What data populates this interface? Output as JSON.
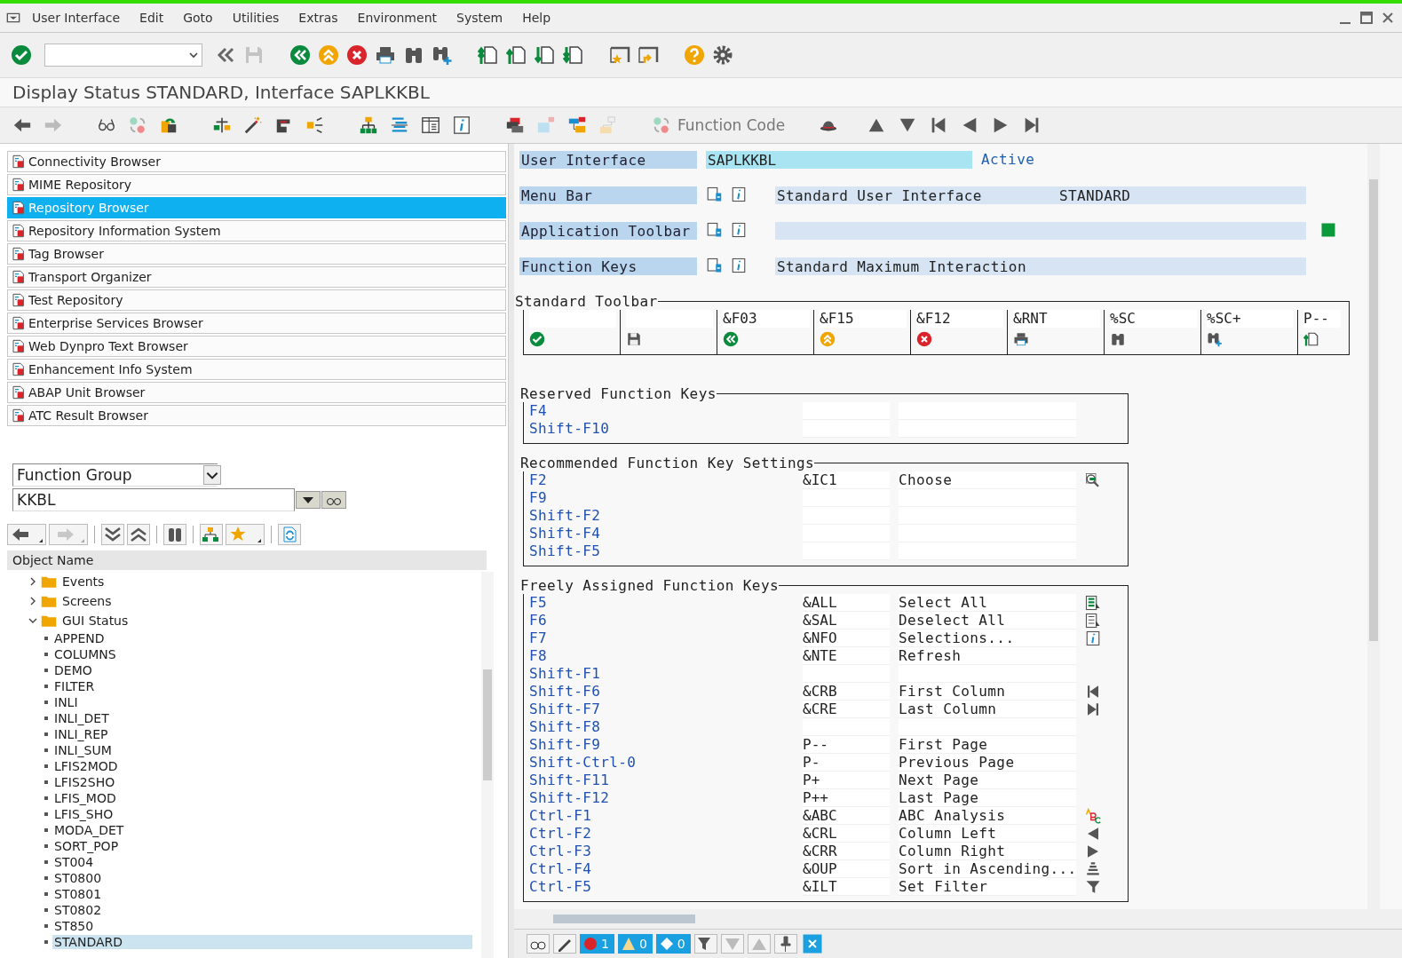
{
  "menu_bar": [
    "User Interface",
    "Edit",
    "Goto",
    "Utilities",
    "Extras",
    "Environment",
    "System",
    "Help"
  ],
  "title": "Display Status STANDARD, Interface SAPLKKBL",
  "app_toolbar": {
    "function_code": "Function Code"
  },
  "navigator": {
    "items": [
      {
        "label": "Connectivity Browser",
        "selected": false
      },
      {
        "label": "MIME Repository",
        "selected": false
      },
      {
        "label": "Repository Browser",
        "selected": true
      },
      {
        "label": "Repository Information System",
        "selected": false
      },
      {
        "label": "Tag Browser",
        "selected": false
      },
      {
        "label": "Transport Organizer",
        "selected": false
      },
      {
        "label": "Test Repository",
        "selected": false
      },
      {
        "label": "Enterprise Services Browser",
        "selected": false
      },
      {
        "label": "Web Dynpro Text Browser",
        "selected": false
      },
      {
        "label": "Enhancement Info System",
        "selected": false
      },
      {
        "label": "ABAP Unit Browser",
        "selected": false
      },
      {
        "label": "ATC Result Browser",
        "selected": false
      }
    ]
  },
  "object_selector": {
    "type": "Function Group",
    "name": "KKBL"
  },
  "tree": {
    "column": "Object Name",
    "items": [
      {
        "label": "Events",
        "expanded": false
      },
      {
        "label": "Screens",
        "expanded": false
      },
      {
        "label": "GUI Status",
        "expanded": true,
        "children": [
          {
            "label": "APPEND",
            "selected": false
          },
          {
            "label": "COLUMNS",
            "selected": false
          },
          {
            "label": "DEMO",
            "selected": false
          },
          {
            "label": "FILTER",
            "selected": false
          },
          {
            "label": "INLI",
            "selected": false
          },
          {
            "label": "INLI_DET",
            "selected": false
          },
          {
            "label": "INLI_REP",
            "selected": false
          },
          {
            "label": "INLI_SUM",
            "selected": false
          },
          {
            "label": "LFIS2MOD",
            "selected": false
          },
          {
            "label": "LFIS2SHO",
            "selected": false
          },
          {
            "label": "LFIS_MOD",
            "selected": false
          },
          {
            "label": "LFIS_SHO",
            "selected": false
          },
          {
            "label": "MODA_DET",
            "selected": false
          },
          {
            "label": "SORT_POP",
            "selected": false
          },
          {
            "label": "ST004",
            "selected": false
          },
          {
            "label": "ST0800",
            "selected": false
          },
          {
            "label": "ST0801",
            "selected": false
          },
          {
            "label": "ST0802",
            "selected": false
          },
          {
            "label": "ST850",
            "selected": false
          },
          {
            "label": "STANDARD",
            "selected": true
          }
        ]
      }
    ]
  },
  "header": {
    "user_interface": {
      "label": "User Interface",
      "value": "SAPLKKBL",
      "status": "Active"
    },
    "rows": [
      {
        "label": "Menu Bar",
        "text": "Standard User Interface",
        "code": "STANDARD"
      },
      {
        "label": "Application Toolbar"
      },
      {
        "label": "Function Keys",
        "text": "Standard Maximum Interaction"
      }
    ]
  },
  "standard_toolbar": {
    "title": "Standard Toolbar",
    "cells": [
      {},
      {},
      {
        "code": "&F03"
      },
      {
        "code": "&F15"
      },
      {
        "code": "&F12"
      },
      {
        "code": "&RNT"
      },
      {
        "code": "%SC"
      },
      {
        "code": "%SC+"
      },
      {
        "code": "P--"
      }
    ]
  },
  "reserved_keys": {
    "title": "Reserved Function Keys",
    "rows": [
      {
        "key": "F4"
      },
      {
        "key": "Shift-F10"
      }
    ]
  },
  "recommended_keys": {
    "title": "Recommended Function Key Settings",
    "rows": [
      {
        "key": "F2",
        "code": "&IC1",
        "text": "Choose"
      },
      {
        "key": "F9"
      },
      {
        "key": "Shift-F2"
      },
      {
        "key": "Shift-F4"
      },
      {
        "key": "Shift-F5"
      }
    ]
  },
  "free_keys": {
    "title": "Freely Assigned Function Keys",
    "rows": [
      {
        "key": "F5",
        "code": "&ALL",
        "text": "Select All"
      },
      {
        "key": "F6",
        "code": "&SAL",
        "text": "Deselect All"
      },
      {
        "key": "F7",
        "code": "&NFO",
        "text": "Selections..."
      },
      {
        "key": "F8",
        "code": "&NTE",
        "text": "Refresh"
      },
      {
        "key": "Shift-F1"
      },
      {
        "key": "Shift-F6",
        "code": "&CRB",
        "text": "First Column"
      },
      {
        "key": "Shift-F7",
        "code": "&CRE",
        "text": "Last Column"
      },
      {
        "key": "Shift-F8"
      },
      {
        "key": "Shift-F9",
        "code": "P--",
        "text": "First Page"
      },
      {
        "key": "Shift-Ctrl-0",
        "code": "P-",
        "text": "Previous Page"
      },
      {
        "key": "Shift-F11",
        "code": "P+",
        "text": "Next Page"
      },
      {
        "key": "Shift-F12",
        "code": "P++",
        "text": "Last Page"
      },
      {
        "key": "Ctrl-F1",
        "code": "&ABC",
        "text": "ABC Analysis"
      },
      {
        "key": "Ctrl-F2",
        "code": "&CRL",
        "text": "Column Left"
      },
      {
        "key": "Ctrl-F3",
        "code": "&CRR",
        "text": "Column Right"
      },
      {
        "key": "Ctrl-F4",
        "code": "&OUP",
        "text": "Sort in Ascending..."
      },
      {
        "key": "Ctrl-F5",
        "code": "&ILT",
        "text": "Set Filter"
      }
    ]
  },
  "message_counts": [
    {
      "kind": "error",
      "count": "1"
    },
    {
      "kind": "warning",
      "count": "0"
    },
    {
      "kind": "info",
      "count": "0"
    }
  ]
}
